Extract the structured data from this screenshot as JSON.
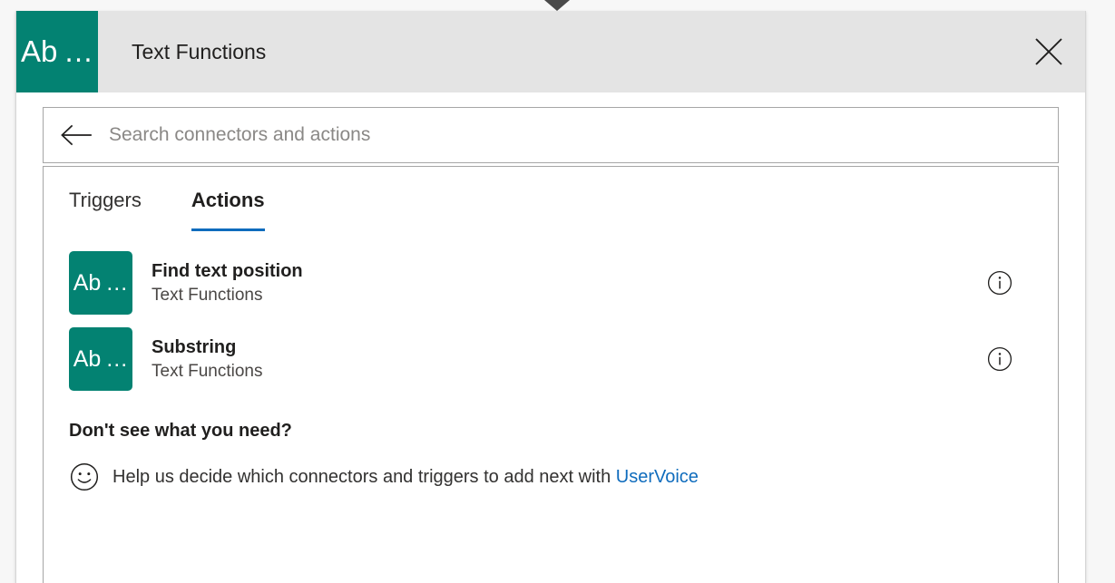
{
  "dialog": {
    "icon_label": "Ab …",
    "title": "Text Functions",
    "close_label": "Close"
  },
  "search": {
    "back_label": "Back",
    "placeholder": "Search connectors and actions",
    "value": ""
  },
  "tabs": [
    {
      "label": "Triggers",
      "active": false
    },
    {
      "label": "Actions",
      "active": true
    }
  ],
  "actions": [
    {
      "icon_label": "Ab …",
      "title": "Find text position",
      "subtitle": "Text Functions",
      "info_label": "i"
    },
    {
      "icon_label": "Ab …",
      "title": "Substring",
      "subtitle": "Text Functions",
      "info_label": "i"
    }
  ],
  "footer": {
    "heading": "Don't see what you need?",
    "text_before": "Help us decide which connectors and triggers to add next with",
    "link_label": "UserVoice"
  },
  "colors": {
    "brand_teal": "#038272",
    "accent_blue": "#0f6cbd",
    "titlebar_bg": "#e4e4e4",
    "border_gray": "#a6a6a6",
    "page_bg": "#f7f7f7"
  }
}
